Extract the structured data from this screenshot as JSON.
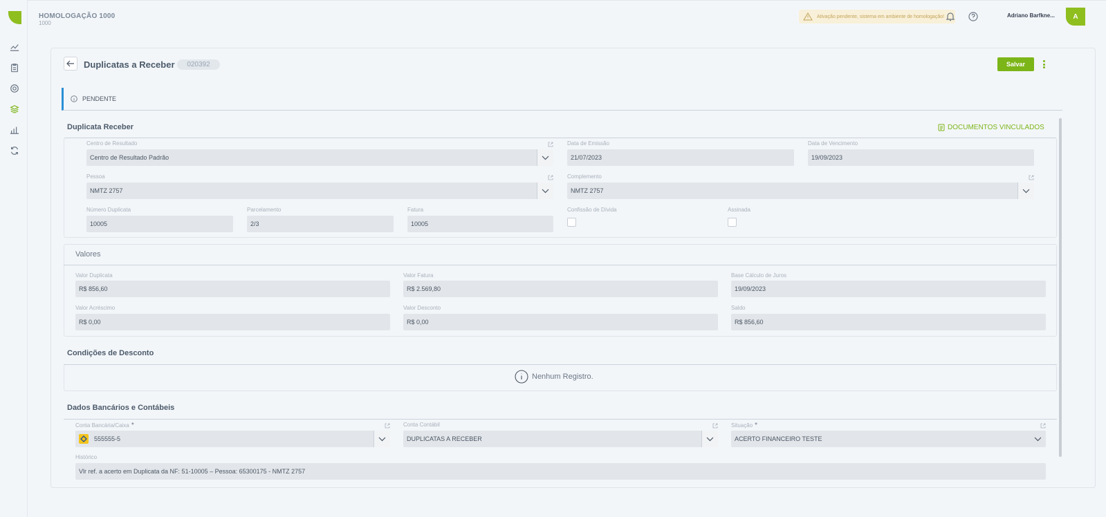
{
  "env": {
    "title": "HOMOLOGAÇÃO 1000",
    "subtitle": "1000"
  },
  "warning": {
    "text": "Ativação pendente, sistema em ambiente de homologação!"
  },
  "user": {
    "name": "Adriano Barfkne...",
    "initial": "A"
  },
  "sidebar": {
    "icons": [
      "chart-line-icon",
      "clipboard-icon",
      "settings-icon",
      "layers-icon",
      "bar-chart-icon",
      "refresh-icon"
    ]
  },
  "page": {
    "title": "Duplicatas a Receber",
    "code": "020392",
    "save_label": "Salvar"
  },
  "status": {
    "text": "PENDENTE"
  },
  "section1": {
    "title": "Duplicata Receber",
    "docs_link": "DOCUMENTOS VINCULADOS",
    "centro": {
      "label": "Centro de Resultado",
      "value": "Centro de Resultado Padrão"
    },
    "emissao": {
      "label": "Data de Emissão",
      "value": "21/07/2023"
    },
    "vencimento": {
      "label": "Data de Vencimento",
      "value": "19/09/2023"
    },
    "pessoa": {
      "label": "Pessoa",
      "value": "NMTZ 2757"
    },
    "complemento": {
      "label": "Complemento",
      "value": "NMTZ 2757"
    },
    "numero": {
      "label": "Número Duplicata",
      "value": "10005"
    },
    "parcelamento": {
      "label": "Parcelamento",
      "value": "2/3"
    },
    "fatura": {
      "label": "Fatura",
      "value": "10005"
    },
    "confissao": {
      "label": "Confissão de Dívida"
    },
    "assinada": {
      "label": "Assinada"
    }
  },
  "valores": {
    "title": "Valores",
    "valor_duplicata": {
      "label": "Valor Duplicata",
      "value": "R$ 856,60"
    },
    "valor_fatura": {
      "label": "Valor Fatura",
      "value": "R$ 2.569,80"
    },
    "base_juros": {
      "label": "Base Cálculo de Juros",
      "value": "19/09/2023"
    },
    "acrescimo": {
      "label": "Valor Acréscimo",
      "value": "R$ 0,00"
    },
    "desconto": {
      "label": "Valor Desconto",
      "value": "R$ 0,00"
    },
    "saldo": {
      "label": "Saldo",
      "value": "R$ 856,60"
    }
  },
  "condicoes": {
    "title": "Condições de Desconto",
    "empty": "Nenhum Registro."
  },
  "bancarios": {
    "title": "Dados Bancários e Contábeis",
    "conta_bancaria": {
      "label": "Conta Bancária/Caixa",
      "value": "555555-5"
    },
    "conta_contabil": {
      "label": "Conta Contábil",
      "value": "DUPLICATAS A RECEBER"
    },
    "situacao": {
      "label": "Situação",
      "value": "ACERTO FINANCEIRO TESTE"
    },
    "historico": {
      "label": "Histórico",
      "value": "Vlr ref. a acerto em Duplicata da NF: 51-10005 – Pessoa: 65300175 - NMTZ 2757"
    }
  },
  "colors": {
    "accent": "#7cb518",
    "info": "#2b8fd6",
    "warning_bg": "#f8f0d8"
  }
}
